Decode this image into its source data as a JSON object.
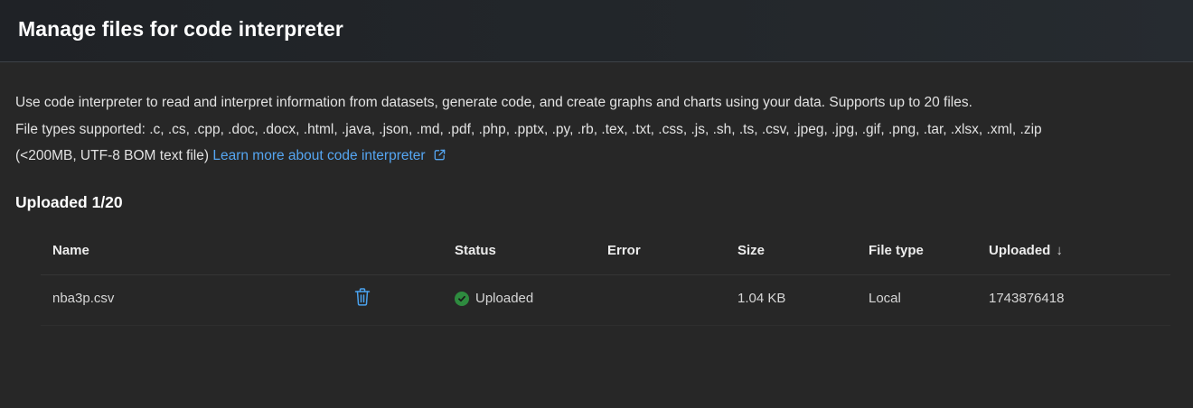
{
  "header": {
    "title": "Manage files for code interpreter"
  },
  "description": {
    "line1": "Use code interpreter to read and interpret information from datasets, generate code, and create graphs and charts using your data. Supports up to 20 files.",
    "line2": "File types supported: .c, .cs, .cpp, .doc, .docx, .html, .java, .json, .md, .pdf, .php, .pptx, .py, .rb, .tex, .txt, .css, .js, .sh, .ts, .csv, .jpeg, .jpg, .gif, .png, .tar, .xlsx, .xml, .zip",
    "line3_prefix": "(<200MB, UTF-8 BOM text file)",
    "learn_more_link": "Learn more about code interpreter",
    "link_icon": "external-link-icon"
  },
  "uploaded": {
    "heading": "Uploaded 1/20"
  },
  "table": {
    "columns": {
      "name": "Name",
      "status": "Status",
      "error": "Error",
      "size": "Size",
      "file_type": "File type",
      "uploaded": "Uploaded",
      "sort_icon": "sort-descending-icon"
    },
    "rows": [
      {
        "name": "nba3p.csv",
        "delete_icon": "trash-icon",
        "status": "Uploaded",
        "status_icon": "check-circle-icon",
        "error": "",
        "size": "1.04 KB",
        "file_type": "Local",
        "uploaded": "1743876418"
      }
    ]
  },
  "colors": {
    "background": "#272727",
    "link": "#55a6f2",
    "success": "#2e8b3f",
    "delete_icon": "#4aa3f0"
  }
}
